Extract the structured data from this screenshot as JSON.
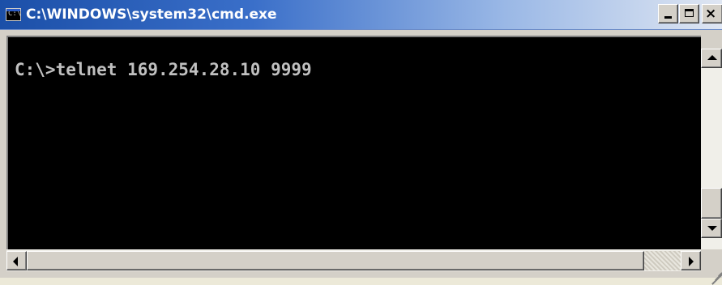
{
  "window": {
    "title": "C:\\WINDOWS\\system32\\cmd.exe",
    "icon": "cmd-icon",
    "icon_text": "C:\\",
    "controls": {
      "minimize": "minimize-icon",
      "maximize": "maximize-icon",
      "close": "close-icon",
      "close_glyph": "×"
    }
  },
  "console": {
    "lines": [
      "C:\\>telnet 169.254.28.10 9999"
    ],
    "background": "#000000",
    "foreground": "#c0c0c0"
  },
  "scrollbars": {
    "vertical": {
      "up": "scroll-up-arrow",
      "down": "scroll-down-arrow"
    },
    "horizontal": {
      "left": "scroll-left-arrow",
      "right": "scroll-right-arrow"
    }
  },
  "colors": {
    "titlebar_start": "#1b4fa8",
    "titlebar_end": "#dfe6f2",
    "chrome": "#d4d0c8"
  }
}
